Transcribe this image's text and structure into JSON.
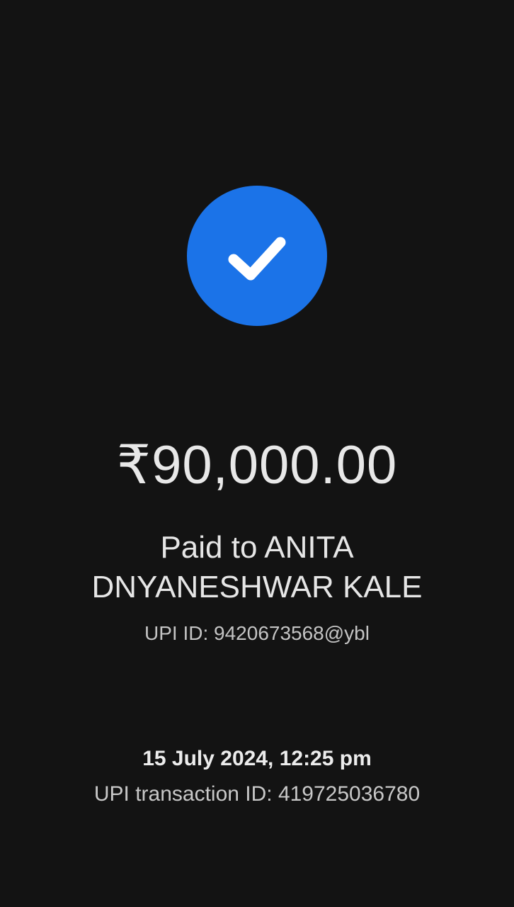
{
  "status": {
    "icon": "check-icon",
    "accent_color": "#1b73e8"
  },
  "payment": {
    "amount": "₹90,000.00",
    "paid_to": "Paid to ANITA DNYANESHWAR KALE",
    "upi_id": "UPI ID: 9420673568@ybl",
    "datetime": "15 July 2024, 12:25 pm",
    "transaction_id": "UPI transaction ID: 419725036780"
  }
}
